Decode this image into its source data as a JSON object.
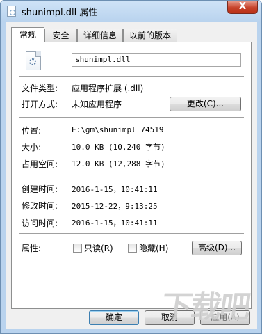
{
  "window": {
    "title": "shunimpl.dll 属性",
    "close_label": "X"
  },
  "tabs": [
    {
      "label": "常规",
      "active": true
    },
    {
      "label": "安全",
      "active": false
    },
    {
      "label": "详细信息",
      "active": false
    },
    {
      "label": "以前的版本",
      "active": false
    }
  ],
  "general": {
    "file_name": "shunimpl.dll",
    "file_type_label": "文件类型:",
    "file_type_value": "应用程序扩展 (.dll)",
    "opens_with_label": "打开方式:",
    "opens_with_value": "未知应用程序",
    "change_button": "更改(C)...",
    "location_label": "位置:",
    "location_value": "E:\\gm\\shunimpl_74519",
    "size_label": "大小:",
    "size_value": "10.0 KB (10,240 字节)",
    "size_on_disk_label": "占用空间:",
    "size_on_disk_value": "12.0 KB (12,288 字节)",
    "created_label": "创建时间:",
    "created_value": "2016-1-15，10:41:11",
    "modified_label": "修改时间:",
    "modified_value": "2015-12-22，9:13:25",
    "accessed_label": "访问时间:",
    "accessed_value": "2016-1-15，10:41:11",
    "attributes_label": "属性:",
    "readonly_label": "只读(R)",
    "hidden_label": "隐藏(H)",
    "advanced_button": "高级(D)..."
  },
  "footer": {
    "ok_button": "确定",
    "cancel_button": "取消",
    "apply_button": "应用(A)"
  },
  "watermark": "下载吧"
}
